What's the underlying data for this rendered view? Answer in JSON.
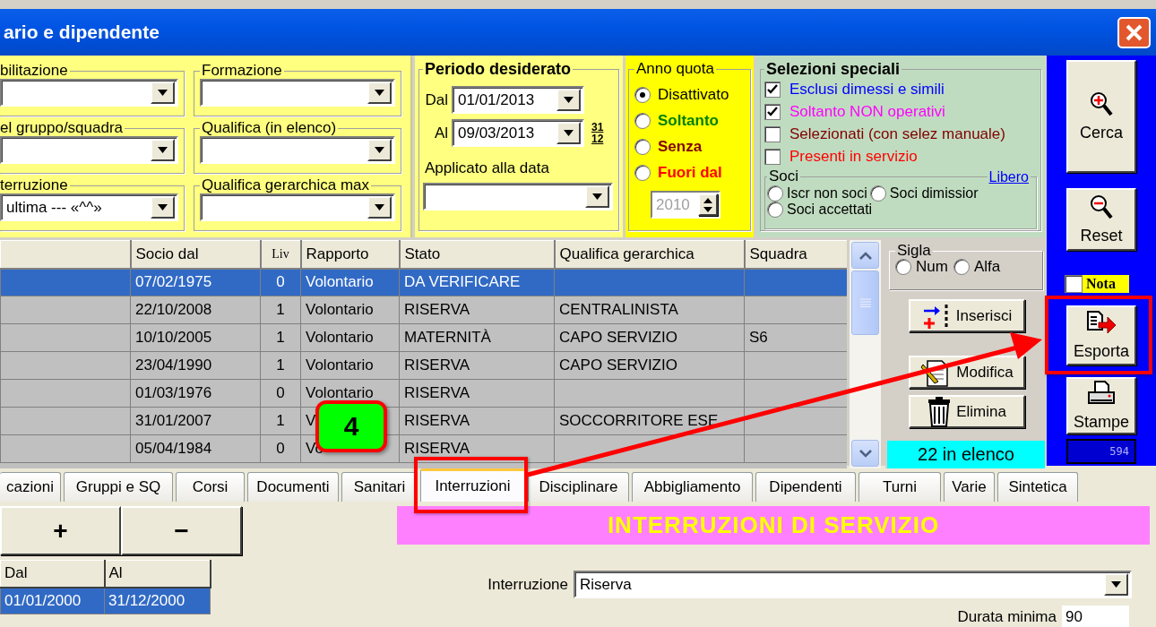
{
  "window": {
    "title": "ario e dipendente"
  },
  "filters": [
    {
      "label": "bilitazione"
    },
    {
      "label": "Formazione"
    },
    {
      "label": "el gruppo/squadra"
    },
    {
      "label": "Qualifica (in elenco)"
    },
    {
      "label": "terruzione",
      "value": "ultima --- «^^»"
    },
    {
      "label": "Qualifica gerarchica max"
    }
  ],
  "periodo": {
    "title": "Periodo desiderato",
    "dal_label": "Dal",
    "dal": "01/01/2013",
    "al_label": "Al",
    "al": "09/03/2013",
    "calendar_day": "31",
    "calendar_month": "12",
    "applied_label": "Applicato alla data"
  },
  "anno_quota": {
    "title": "Anno quota",
    "options": [
      {
        "label": "Disattivato",
        "selected": true,
        "bold": false,
        "color": "#000000"
      },
      {
        "label": "Soltanto",
        "selected": false,
        "bold": true,
        "color": "#008000"
      },
      {
        "label": "Senza",
        "selected": false,
        "bold": true,
        "color": "#800000"
      },
      {
        "label": "Fuori dal",
        "selected": false,
        "bold": true,
        "color": "#ff0000"
      }
    ],
    "year": "2010",
    "disabled": true
  },
  "selezioni": {
    "title": "Selezioni speciali",
    "checks": [
      {
        "label": "Esclusi dimessi e simili",
        "checked": true,
        "color": "#0000ff"
      },
      {
        "label": "Soltanto NON operativi",
        "checked": true,
        "color": "#ff00ff"
      },
      {
        "label": "Selezionati (con selez manuale)",
        "checked": false,
        "color": "#800000"
      },
      {
        "label": "Presenti in servizio",
        "checked": false,
        "color": "#ff0000"
      }
    ],
    "soci": {
      "title": "Soci",
      "link": "Libero",
      "options": [
        {
          "label": "Iscr non soci",
          "selected": false
        },
        {
          "label": "Soci dimissior",
          "selected": false
        },
        {
          "label": "Soci accettati",
          "selected": false
        }
      ]
    }
  },
  "grid": {
    "columns": [
      "Socio dal",
      "Liv",
      "Rapporto",
      "Stato",
      "Qualifica gerarchica",
      "Squadra"
    ],
    "rows": [
      {
        "socio_dal": "07/02/1975",
        "liv": "0",
        "rapporto": "Volontario",
        "stato": "DA VERIFICARE",
        "selected": true
      },
      {
        "socio_dal": "22/10/2008",
        "liv": "1",
        "rapporto": "Volontario",
        "stato": "RISERVA",
        "qualifica": "CENTRALINISTA",
        "selected": false
      },
      {
        "socio_dal": "10/10/2005",
        "liv": "1",
        "rapporto": "Volontario",
        "stato": "MATERNITÀ",
        "qualifica": "CAPO SERVIZIO",
        "squadra": "S6",
        "selected": false
      },
      {
        "socio_dal": "23/04/1990",
        "liv": "1",
        "rapporto": "Volontario",
        "stato": "RISERVA",
        "qualifica": "CAPO SERVIZIO",
        "selected": false
      },
      {
        "socio_dal": "01/03/1976",
        "liv": "0",
        "rapporto": "Volontario",
        "stato": "RISERVA",
        "selected": false
      },
      {
        "socio_dal": "31/01/2007",
        "liv": "1",
        "rapporto": "V",
        "stato": "RISERVA",
        "qualifica": "SOCCORRITORE ESE",
        "selected": false
      },
      {
        "socio_dal": "05/04/1984",
        "liv": "0",
        "rapporto": "Vo",
        "stato": "RISERVA",
        "selected": false
      }
    ]
  },
  "sigla": {
    "title": "Sigla",
    "options": [
      {
        "label": "Num",
        "selected": false
      },
      {
        "label": "Alfa",
        "selected": false
      }
    ]
  },
  "actions": [
    {
      "kind": "insert",
      "label": "Inserisci"
    },
    {
      "kind": "edit",
      "label": "Modifica"
    },
    {
      "kind": "delete",
      "label": "Elimina"
    }
  ],
  "count": "22 in elenco",
  "tools": [
    {
      "kind": "search",
      "label": "Cerca"
    },
    {
      "kind": "reset",
      "label": "Reset"
    },
    {
      "kind": "note",
      "label": "Nota",
      "checked": false
    },
    {
      "kind": "export",
      "label": "Esporta"
    },
    {
      "kind": "print",
      "label": "Stampe"
    },
    {
      "kind": "counter",
      "label": "594"
    }
  ],
  "tabs": [
    {
      "label": "cazioni",
      "selected": false
    },
    {
      "label": "Gruppi e SQ",
      "selected": false
    },
    {
      "label": "Corsi",
      "selected": false
    },
    {
      "label": "Documenti",
      "selected": false
    },
    {
      "label": "Sanitari",
      "selected": false
    },
    {
      "label": "Interruzioni",
      "selected": true
    },
    {
      "label": "Disciplinare",
      "selected": false
    },
    {
      "label": "Abbigliamento",
      "selected": false
    },
    {
      "label": "Dipendenti",
      "selected": false
    },
    {
      "label": "Turni",
      "selected": false
    },
    {
      "label": "Varie",
      "selected": false
    },
    {
      "label": "Sintetica",
      "selected": false
    }
  ],
  "interruzioni": {
    "add": "+",
    "remove": "−",
    "columns": [
      "Dal",
      "Al"
    ],
    "rows": [
      {
        "dal": "01/01/2000",
        "al": "31/12/2000",
        "selected": true
      }
    ],
    "title": "INTERRUZIONI DI SERVIZIO",
    "field_label": "Interruzione",
    "field_value": "Riserva",
    "duration_label": "Durata minima",
    "duration": "90"
  },
  "annotation": {
    "badge": "4"
  }
}
